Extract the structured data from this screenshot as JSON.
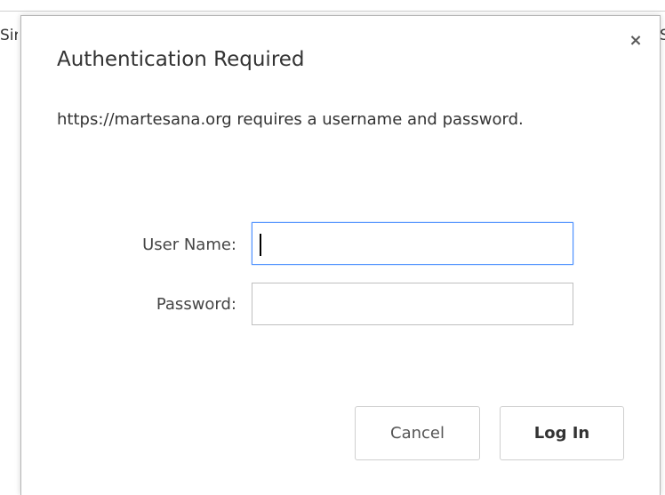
{
  "background": {
    "left_text": "Sir",
    "right_text": "S"
  },
  "dialog": {
    "title": "Authentication Required",
    "message": "https://martesana.org requires a username and password.",
    "close_glyph": "×",
    "fields": {
      "username_label": "User Name:",
      "username_value": "",
      "password_label": "Password:",
      "password_value": ""
    },
    "buttons": {
      "cancel": "Cancel",
      "login": "Log In"
    },
    "colors": {
      "focus_border": "#4d90fe",
      "text": "#333333"
    }
  }
}
